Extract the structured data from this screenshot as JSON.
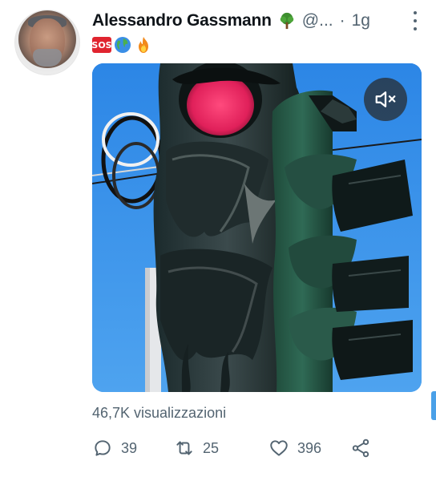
{
  "tweet": {
    "author_name": "Alessandro Gassmann",
    "handle": "@...",
    "separator": "·",
    "time": "1g",
    "badges": {
      "sos": "SOS",
      "name_icon": "tree-icon",
      "globe_icon": "globe-icon",
      "fire_icon": "fire-icon"
    }
  },
  "media": {
    "description_icon": "melted-traffic-light",
    "mute_icon": "muted-speaker-icon"
  },
  "stats": {
    "views": "46,7K visualizzazioni"
  },
  "actions": {
    "replies": "39",
    "retweets": "25",
    "likes": "396"
  },
  "colors": {
    "text_primary": "#0f1419",
    "text_secondary": "#536471",
    "sos_red": "#e0242f"
  }
}
